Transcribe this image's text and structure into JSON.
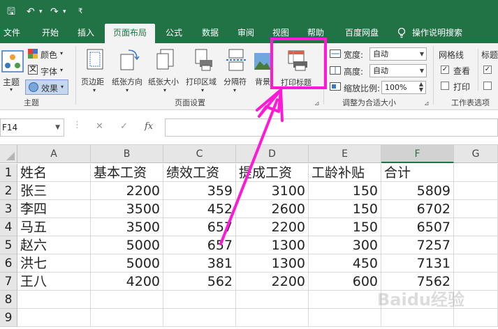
{
  "quick_access": {
    "save": "🖫",
    "undo": "↶",
    "redo": "↷",
    "more": "₹"
  },
  "tabs": [
    "文件",
    "开始",
    "插入",
    "页面布局",
    "公式",
    "数据",
    "审阅",
    "视图",
    "帮助",
    "百度网盘",
    "操作说明搜索"
  ],
  "active_tab": "页面布局",
  "ribbon": {
    "theme": {
      "btn": "主题",
      "colors": "颜色",
      "fonts": "字体",
      "effects": "效果",
      "group": "主题"
    },
    "page_setup": {
      "margins": "页边距",
      "orientation": "纸张方向",
      "size": "纸张大小",
      "print_area": "打印区域",
      "breaks": "分隔符",
      "background": "背景",
      "print_titles": "打印标题",
      "group": "页面设置"
    },
    "scale": {
      "width_label": "宽度:",
      "width_value": "自动",
      "height_label": "高度:",
      "height_value": "自动",
      "scale_label": "缩放比例:",
      "scale_value": "100%",
      "group": "调整为合适大小"
    },
    "sheet": {
      "gridlines": "网格线",
      "headings": "标题",
      "view": "查看",
      "print": "打印",
      "group": "工作表选项"
    }
  },
  "formula_bar": {
    "name_box": "F14",
    "cancel": "✕",
    "enter": "✓",
    "fx": "fx"
  },
  "columns": [
    "A",
    "B",
    "C",
    "D",
    "E",
    "F",
    "G"
  ],
  "selected_column": "F",
  "rows": [
    "1",
    "2",
    "3",
    "4",
    "5",
    "6",
    "7",
    "8",
    "9"
  ],
  "table": {
    "header": [
      "姓名",
      "基本工资",
      "绩效工资",
      "提成工资",
      "工龄补贴",
      "合计"
    ],
    "data": [
      [
        "张三",
        "2200",
        "359",
        "3100",
        "150",
        "5809"
      ],
      [
        "李四",
        "3500",
        "452",
        "2600",
        "150",
        "6702"
      ],
      [
        "马五",
        "3500",
        "657",
        "2200",
        "150",
        "6507"
      ],
      [
        "赵六",
        "5000",
        "657",
        "1300",
        "300",
        "7257"
      ],
      [
        "洪七",
        "5000",
        "381",
        "1300",
        "450",
        "7131"
      ],
      [
        "王八",
        "4200",
        "562",
        "2200",
        "600",
        "7562"
      ]
    ]
  },
  "watermark": "Baidu经验",
  "colors": {
    "excel_green": "#217346",
    "annotation": "#ff18d5"
  }
}
